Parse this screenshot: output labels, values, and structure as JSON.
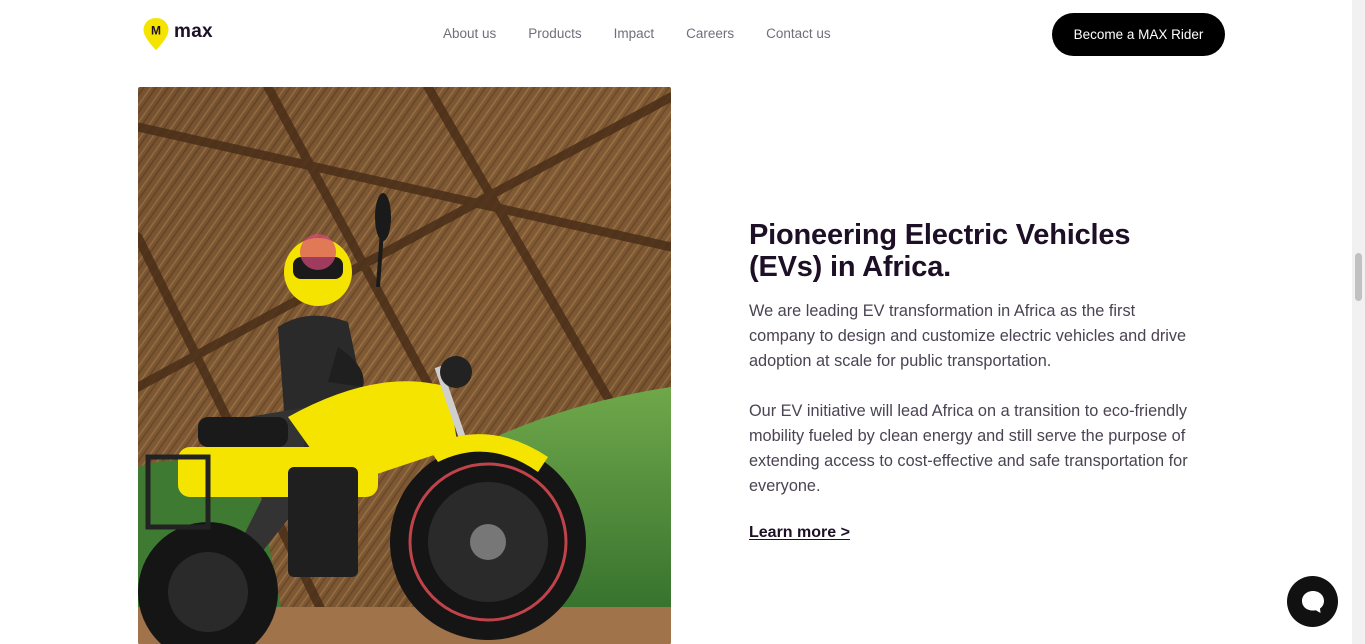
{
  "header": {
    "logo_text": "max",
    "logo_badge": "M",
    "nav": [
      {
        "label": "About us"
      },
      {
        "label": "Products"
      },
      {
        "label": "Impact"
      },
      {
        "label": "Careers"
      },
      {
        "label": "Contact us"
      }
    ],
    "cta_label": "Become a MAX Rider"
  },
  "main": {
    "heading": "Pioneering Electric Vehicles (EVs) in Africa.",
    "paragraphs": [
      "We are leading EV transformation in Africa as the first company to design and customize electric vehicles and drive adoption at scale for public transportation.",
      "Our EV initiative will lead Africa on a transition to eco-friendly mobility fueled by clean energy and still serve the purpose of extending access to cost-effective and safe transportation for everyone."
    ],
    "learn_more": "Learn more >"
  },
  "colors": {
    "brand_yellow": "#f5e400",
    "heading": "#1c0f26",
    "cta_bg": "#000000"
  },
  "icons": {
    "logo": "max-pin-logo-icon",
    "chat": "chat-bubble-icon"
  }
}
